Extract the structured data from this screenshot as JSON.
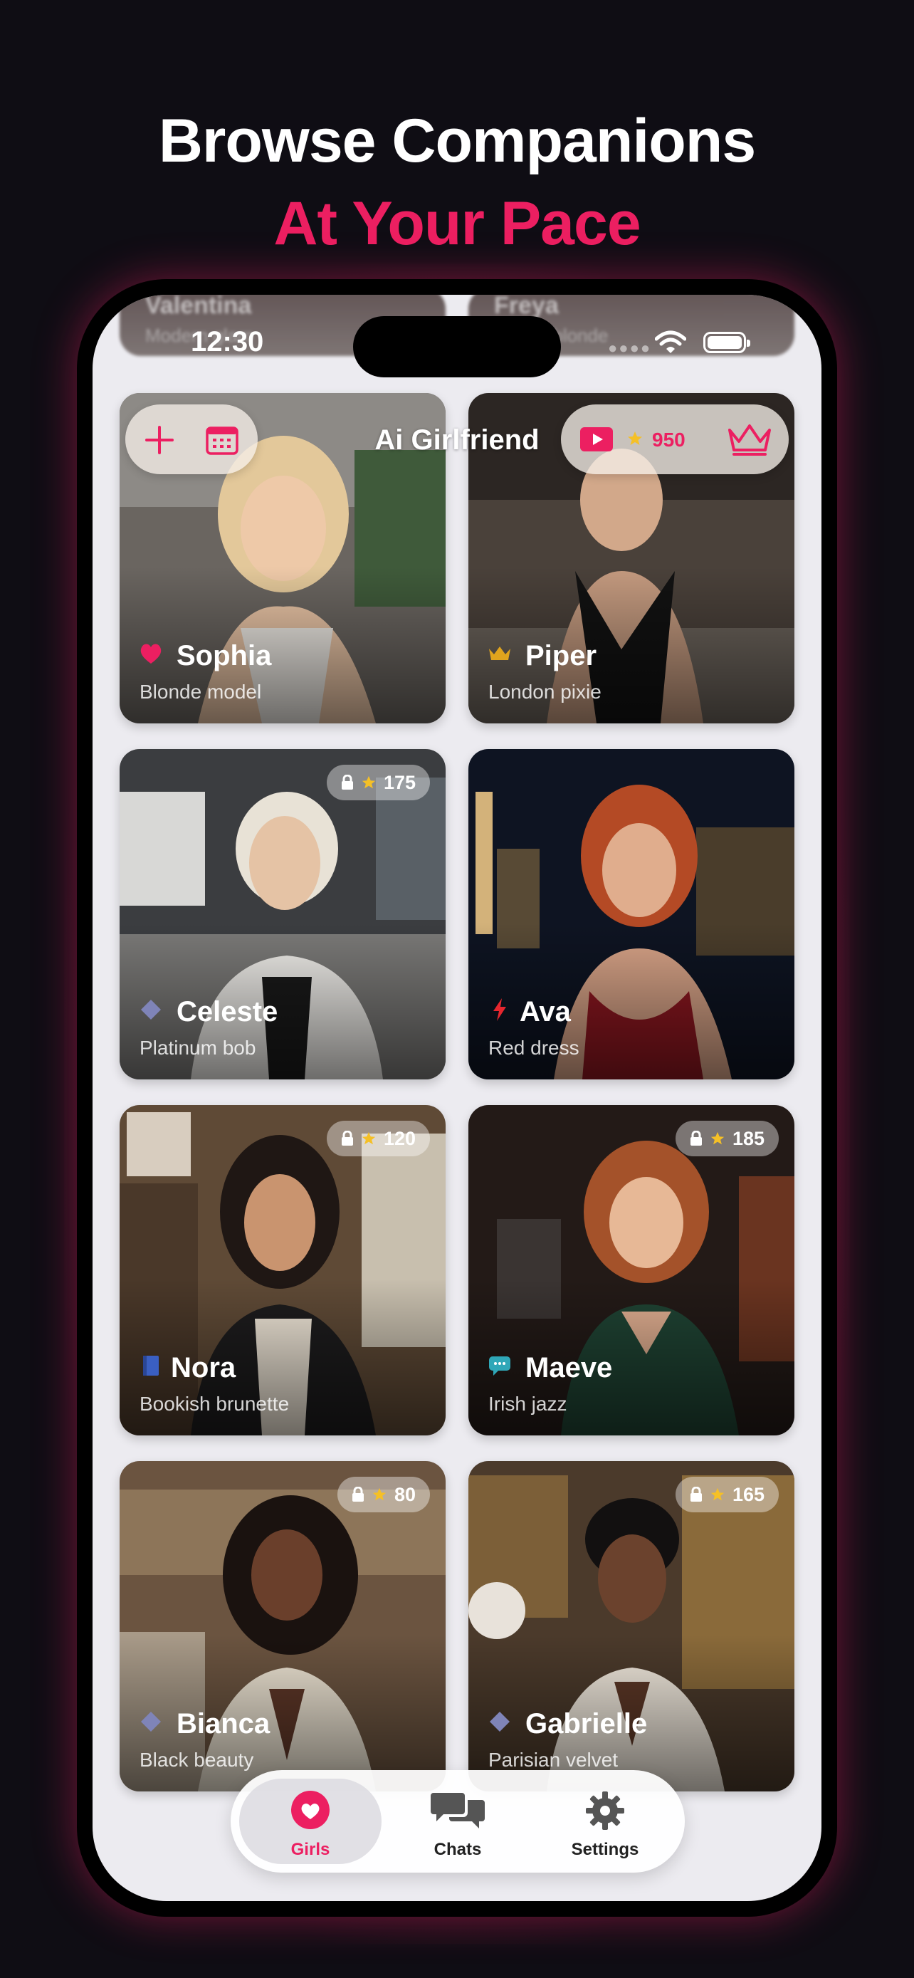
{
  "hero": {
    "line1": "Browse Companions",
    "line2": "At Your Pace"
  },
  "status": {
    "time": "12:30"
  },
  "ghost_row": [
    {
      "name": "Valentina",
      "sub": "Modern glam"
    },
    {
      "name": "Freya",
      "sub": "Nordic blonde"
    }
  ],
  "header": {
    "title": "Ai Girlfriend",
    "coins": "950",
    "add_icon": "plus-icon",
    "calendar_icon": "calendar-icon",
    "video_icon": "video-play-icon",
    "star_icon": "star-icon",
    "premium_icon": "crown-icon"
  },
  "accent": "#ec1f61",
  "companions": [
    {
      "name": "Sophia",
      "subtitle": "Blonde model",
      "icon": "heart-icon",
      "cost": null
    },
    {
      "name": "Piper",
      "subtitle": "London pixie",
      "icon": "crown-icon",
      "cost": null
    },
    {
      "name": "Celeste",
      "subtitle": "Platinum bob",
      "icon": "diamond-icon",
      "cost": "175"
    },
    {
      "name": "Ava",
      "subtitle": "Red dress",
      "icon": "lightning-icon",
      "cost": null
    },
    {
      "name": "Nora",
      "subtitle": "Bookish brunette",
      "icon": "book-icon",
      "cost": "120"
    },
    {
      "name": "Maeve",
      "subtitle": "Irish jazz",
      "icon": "chat-bubble-icon",
      "cost": "185"
    },
    {
      "name": "Bianca",
      "subtitle": "Black beauty",
      "icon": "diamond-icon",
      "cost": "80"
    },
    {
      "name": "Gabrielle",
      "subtitle": "Parisian velvet",
      "icon": "diamond-icon",
      "cost": "165"
    }
  ],
  "tabs": [
    {
      "label": "Girls",
      "icon": "heart-icon",
      "active": true
    },
    {
      "label": "Chats",
      "icon": "chat-bubbles-icon",
      "active": false
    },
    {
      "label": "Settings",
      "icon": "gear-icon",
      "active": false
    }
  ]
}
